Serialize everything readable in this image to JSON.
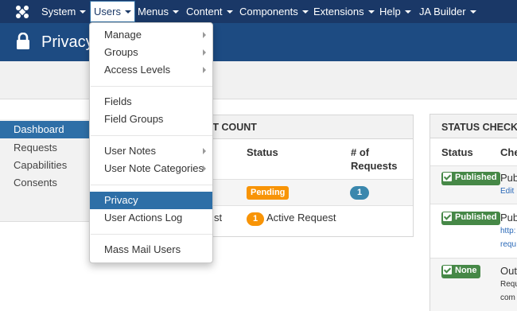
{
  "navbar": {
    "items": [
      {
        "label": "System"
      },
      {
        "label": "Users"
      },
      {
        "label": "Menus"
      },
      {
        "label": "Content"
      },
      {
        "label": "Components"
      },
      {
        "label": "Extensions"
      },
      {
        "label": "Help"
      },
      {
        "label": "JA Builder"
      }
    ],
    "active_index": 1
  },
  "header": {
    "title": "Privacy",
    "icon": "lock-icon"
  },
  "users_menu": {
    "items": [
      {
        "label": "Manage",
        "has_submenu": true
      },
      {
        "label": "Groups",
        "has_submenu": true
      },
      {
        "label": "Access Levels",
        "has_submenu": true
      },
      {
        "label": "Fields",
        "has_submenu": false
      },
      {
        "label": "Field Groups",
        "has_submenu": false
      },
      {
        "label": "User Notes",
        "has_submenu": true
      },
      {
        "label": "User Note Categories",
        "has_submenu": true
      },
      {
        "label": "Privacy",
        "has_submenu": false,
        "active": true
      },
      {
        "label": "User Actions Log",
        "has_submenu": false
      },
      {
        "label": "Mass Mail Users",
        "has_submenu": false
      }
    ]
  },
  "sidebar": {
    "items": [
      {
        "label": "Dashboard",
        "active": true
      },
      {
        "label": "Requests"
      },
      {
        "label": "Capabilities"
      },
      {
        "label": "Consents"
      }
    ]
  },
  "request_panel": {
    "title_visible": "ST COUNT",
    "columns": {
      "status": "Status",
      "requests_line1": "# of",
      "requests_line2": "Requests"
    },
    "rows": [
      {
        "status": "Pending",
        "count": "1"
      },
      {
        "partial_label": "st",
        "badge": "1",
        "status_text": "Active Request"
      }
    ]
  },
  "status_panel": {
    "title": "STATUS CHECK",
    "columns": {
      "status": "Status",
      "check_partial": "Che"
    },
    "rows": [
      {
        "status": "Published",
        "text_partial": "Pub",
        "link_partial": "Edit"
      },
      {
        "status": "Published",
        "text_partial": "Pub",
        "link_line1": "http:",
        "link_line2": "requ"
      },
      {
        "status": "None",
        "text_partial": "Out",
        "sub_line1": "Requ",
        "sub_line2": "com"
      }
    ]
  },
  "colors": {
    "navbar_bg": "#1a3867",
    "header_bg": "#1d4b82",
    "active_blue": "#2e6fa7",
    "warning": "#f89406",
    "success": "#468847",
    "info": "#3a87ad"
  }
}
